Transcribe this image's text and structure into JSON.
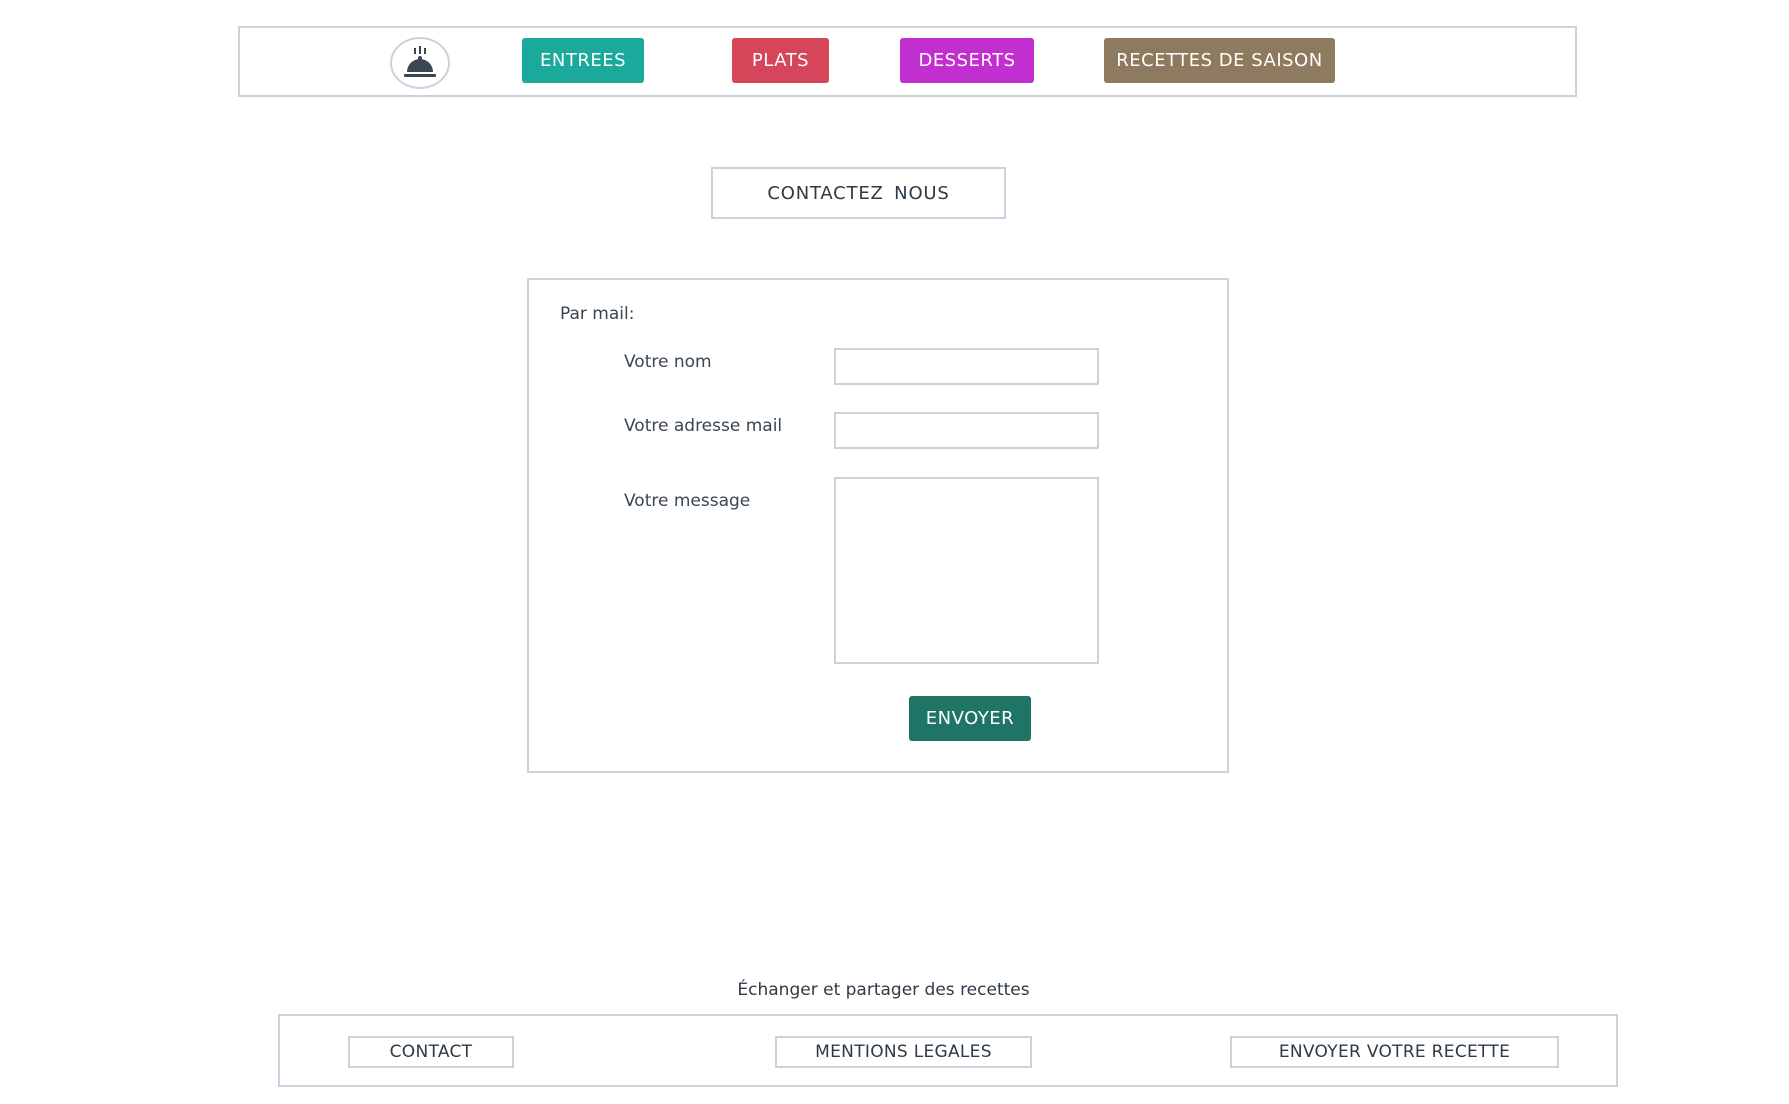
{
  "header": {
    "logo_icon": "serving-cloche-icon",
    "nav": {
      "entrees": "ENTREES",
      "plats": "PLATS",
      "desserts": "DESSERTS",
      "saison": "RECETTES DE SAISON"
    },
    "colors": {
      "entrees": "#1aa99a",
      "plats": "#d6465b",
      "desserts": "#c22fd0",
      "saison": "#8d7a5f"
    }
  },
  "page": {
    "title": "CONTACTEZ  NOUS"
  },
  "form": {
    "section_label": "Par mail:",
    "name_label": "Votre nom",
    "name_value": "",
    "email_label": "Votre adresse mail",
    "email_value": "",
    "message_label": "Votre message",
    "message_value": "",
    "submit_label": "ENVOYER",
    "submit_color": "#1e7565"
  },
  "footer": {
    "tagline": "Échanger et partager des recettes",
    "links": {
      "contact": "CONTACT",
      "mentions": "MENTIONS LEGALES",
      "envoyer": "ENVOYER VOTRE RECETTE"
    }
  }
}
